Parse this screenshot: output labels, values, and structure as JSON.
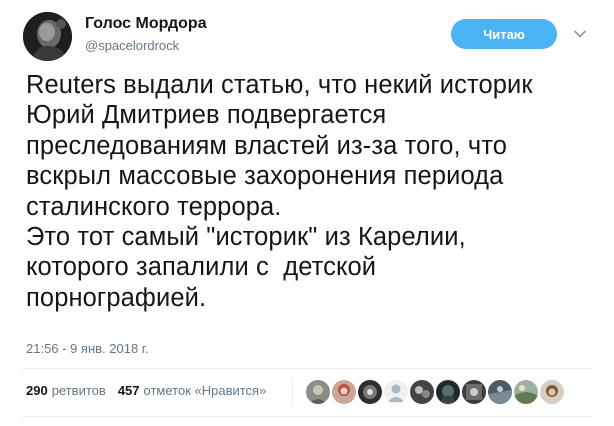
{
  "author": {
    "name": "Голос Мордора",
    "handle": "@spacelordrock"
  },
  "follow_button": {
    "label": "Читаю"
  },
  "tweet": {
    "lines": [
      "Reuters выдали статью, что некий историк",
      "Юрий Дмитриев подвергается",
      "преследованиям властей из-за того, что",
      "вскрыл массовые захоронения периода",
      "сталинского террора.",
      "Это тот самый \"историк\" из Карелии,",
      "которого запалили с  детской",
      "порнографией."
    ],
    "timestamp": "21:56 - 9 янв. 2018 г."
  },
  "stats": {
    "retweets_count": "290",
    "retweets_label": "ретвитов",
    "likes_count": "457",
    "likes_label": "отметок «Нравится»"
  },
  "colors": {
    "accent": "#4ab3f4",
    "secondary_text": "#657786",
    "primary_text": "#14171a",
    "divider": "#e6ecf0"
  },
  "icons": {
    "menu": "chevron-down-icon"
  }
}
